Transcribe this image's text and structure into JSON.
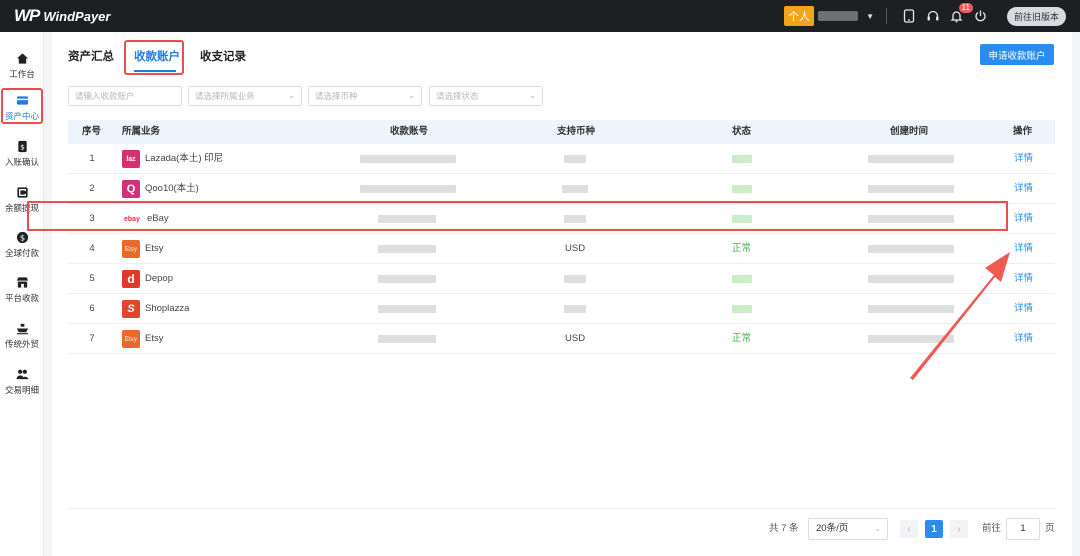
{
  "brand": {
    "mark": "WP",
    "name": "WindPayer"
  },
  "topbar": {
    "account_type": "个人",
    "notification_count": "11",
    "old_version_label": "前往旧版本",
    "icons": [
      "tablet-icon",
      "headset-icon",
      "bell-icon",
      "power-icon"
    ]
  },
  "sidebar": {
    "items": [
      {
        "label": "工作台",
        "icon": "home-icon"
      },
      {
        "label": "资产中心",
        "icon": "card-icon",
        "active": true
      },
      {
        "label": "入账确认",
        "icon": "deposit-icon"
      },
      {
        "label": "余额提现",
        "icon": "withdraw-icon"
      },
      {
        "label": "全球付款",
        "icon": "dollar-icon"
      },
      {
        "label": "平台收款",
        "icon": "store-icon"
      },
      {
        "label": "传统外贸",
        "icon": "ship-icon"
      },
      {
        "label": "交易明细",
        "icon": "users-icon"
      }
    ]
  },
  "tabs": [
    {
      "label": "资产汇总"
    },
    {
      "label": "收款账户",
      "active": true
    },
    {
      "label": "收支记录"
    }
  ],
  "apply_button": "申请收款账户",
  "filters": {
    "account": {
      "placeholder": "请输入收款账户"
    },
    "business": {
      "placeholder": "请选择所属业务"
    },
    "currency": {
      "placeholder": "请选择币种"
    },
    "status": {
      "placeholder": "请选择状态"
    }
  },
  "table": {
    "columns": {
      "index": "序号",
      "business": "所属业务",
      "account": "收款账号",
      "currency": "支持币种",
      "status": "状态",
      "created": "创建时间",
      "action": "操作"
    },
    "rows": [
      {
        "index": "1",
        "platform": "Lazada(本土) 印尼",
        "logo_text": "laz",
        "logo_color": "#d3326e",
        "currency": "",
        "status": "",
        "action": "详情"
      },
      {
        "index": "2",
        "platform": "Qoo10(本土)",
        "logo_text": "Q",
        "logo_color": "#d3327a",
        "currency": "",
        "status": "",
        "action": "详情"
      },
      {
        "index": "3",
        "platform": "eBay",
        "logo_text": "ebay",
        "logo_color": "#ffffff",
        "currency": "",
        "status": "",
        "action": "详情"
      },
      {
        "index": "4",
        "platform": "Etsy",
        "logo_text": "Etsy",
        "logo_color": "#e8692a",
        "currency": "USD",
        "status": "正常",
        "action": "详情"
      },
      {
        "index": "5",
        "platform": "Depop",
        "logo_text": "d",
        "logo_color": "#e23a2a",
        "currency": "",
        "status": "",
        "action": "详情"
      },
      {
        "index": "6",
        "platform": "Shoplazza",
        "logo_text": "S",
        "logo_color": "#e2452e",
        "currency": "",
        "status": "",
        "action": "详情"
      },
      {
        "index": "7",
        "platform": "Etsy",
        "logo_text": "Etsy",
        "logo_color": "#e8692a",
        "currency": "USD",
        "status": "正常",
        "action": "详情"
      }
    ]
  },
  "pagination": {
    "total": "共 7 条",
    "page_size": "20条/页",
    "prev": "‹",
    "current": "1",
    "next": "›",
    "goto_label": "前往",
    "goto_value": "1",
    "page_unit": "页"
  },
  "colors": {
    "accent": "#2b8cf0",
    "highlight": "#e8504a",
    "status_ok": "#46b34a",
    "topbar": "#1d1f23"
  }
}
